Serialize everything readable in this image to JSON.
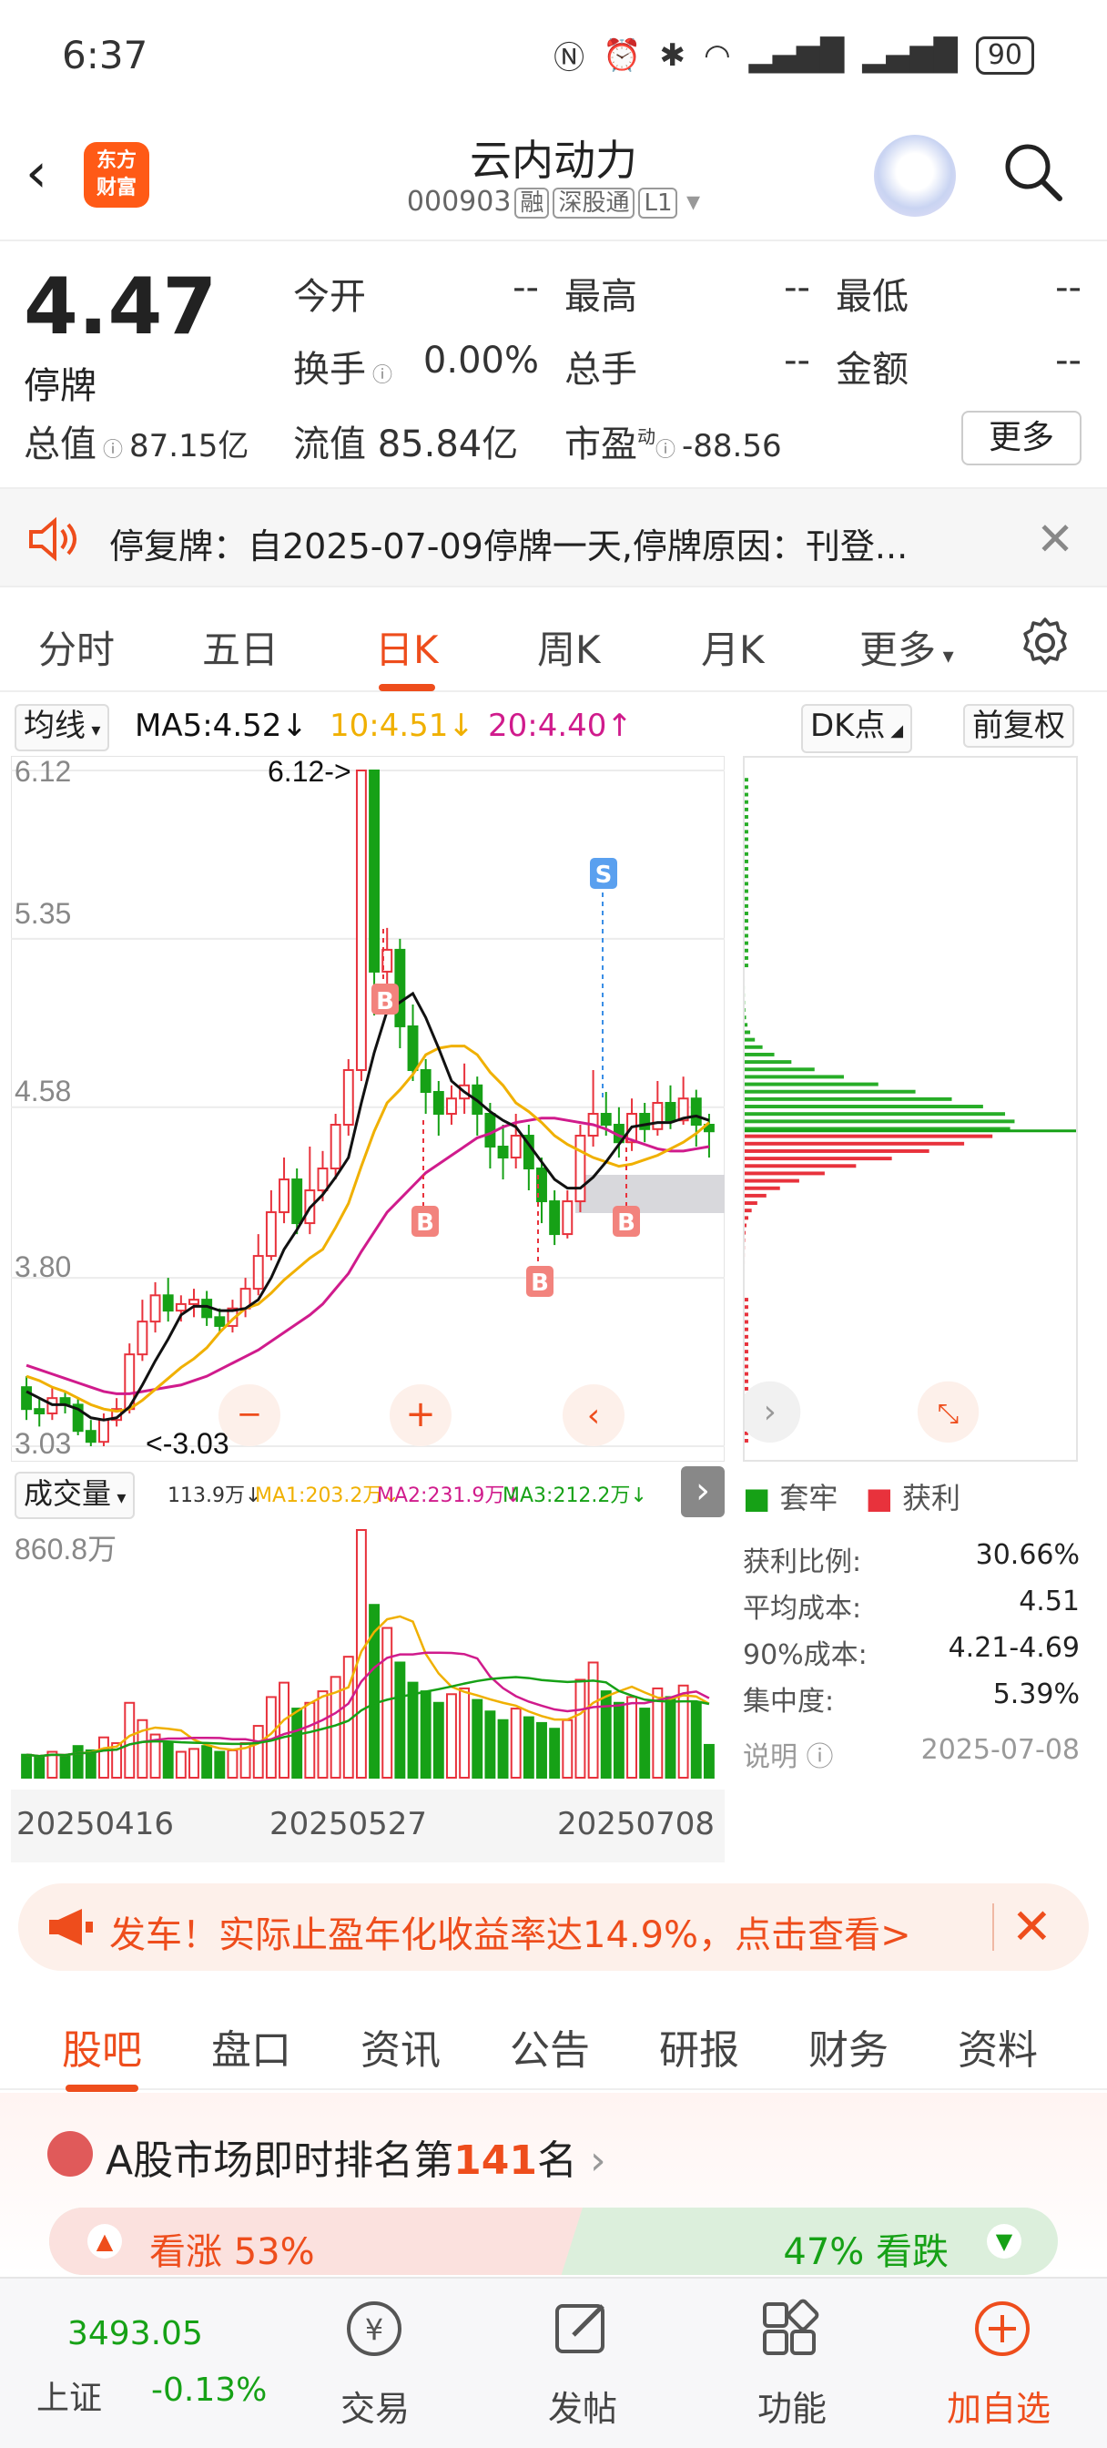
{
  "status_bar": {
    "time": "6:37",
    "battery": "90"
  },
  "header": {
    "logo_line1": "东方",
    "logo_line2": "财富",
    "stock_name": "云内动力",
    "stock_code": "000903",
    "tags": [
      "融",
      "深股通",
      "L1"
    ]
  },
  "quote": {
    "price": "4.47",
    "status": "停牌",
    "fields": [
      {
        "label": "今开",
        "value": "--"
      },
      {
        "label": "最高",
        "value": "--"
      },
      {
        "label": "最低",
        "value": "--"
      },
      {
        "label": "换手",
        "value": "0.00%"
      },
      {
        "label": "总手",
        "value": "--"
      },
      {
        "label": "金额",
        "value": "--"
      }
    ],
    "total_value_label": "总值",
    "total_value": "87.15亿",
    "float_value_label": "流值",
    "float_value": "85.84亿",
    "pe_label": "市盈",
    "pe_sup": "动",
    "pe_value": "-88.56",
    "more": "更多"
  },
  "notice": {
    "text": "停复牌：自2025-07-09停牌一天,停牌原因：刊登..."
  },
  "chart_tabs": [
    "分时",
    "五日",
    "日K",
    "周K",
    "月K",
    "更多"
  ],
  "active_tab": "日K",
  "ma_bar": {
    "selector": "均线",
    "ma5": "MA5:4.52",
    "ma10": "10:4.51",
    "ma20": "20:4.40",
    "dk": "DK点",
    "adjust": "前复权"
  },
  "colors": {
    "accent": "#ee4d1c",
    "up": "#e8323c",
    "down": "#16a116",
    "ma5": "#111111",
    "ma10": "#f0b000",
    "ma20": "#d01b8c"
  },
  "chart_data": {
    "type": "candlestick",
    "y_ticks": [
      "6.12",
      "5.35",
      "4.58",
      "3.80",
      "3.03"
    ],
    "ylim": [
      3.03,
      6.12
    ],
    "max_label": "6.12->",
    "min_label": "<-3.03",
    "signal_labels": [
      "B",
      "B",
      "B",
      "B",
      "S"
    ],
    "candles": [
      [
        3.3,
        3.2,
        3.35,
        3.15
      ],
      [
        3.2,
        3.18,
        3.25,
        3.12
      ],
      [
        3.18,
        3.25,
        3.3,
        3.15
      ],
      [
        3.25,
        3.22,
        3.28,
        3.18
      ],
      [
        3.22,
        3.1,
        3.25,
        3.08
      ],
      [
        3.1,
        3.05,
        3.15,
        3.03
      ],
      [
        3.05,
        3.15,
        3.18,
        3.03
      ],
      [
        3.15,
        3.2,
        3.25,
        3.12
      ],
      [
        3.2,
        3.45,
        3.5,
        3.18
      ],
      [
        3.45,
        3.6,
        3.7,
        3.42
      ],
      [
        3.6,
        3.72,
        3.78,
        3.55
      ],
      [
        3.72,
        3.65,
        3.8,
        3.6
      ],
      [
        3.65,
        3.68,
        3.72,
        3.6
      ],
      [
        3.68,
        3.7,
        3.75,
        3.62
      ],
      [
        3.7,
        3.62,
        3.74,
        3.58
      ],
      [
        3.62,
        3.58,
        3.66,
        3.55
      ],
      [
        3.58,
        3.66,
        3.7,
        3.55
      ],
      [
        3.66,
        3.75,
        3.8,
        3.62
      ],
      [
        3.75,
        3.9,
        4.0,
        3.72
      ],
      [
        3.9,
        4.1,
        4.2,
        3.88
      ],
      [
        4.1,
        4.25,
        4.35,
        4.05
      ],
      [
        4.25,
        4.05,
        4.3,
        4.0
      ],
      [
        4.05,
        4.2,
        4.4,
        4.0
      ],
      [
        4.2,
        4.3,
        4.38,
        4.15
      ],
      [
        4.3,
        4.5,
        4.55,
        4.25
      ],
      [
        4.5,
        4.75,
        4.8,
        4.45
      ],
      [
        4.75,
        6.12,
        6.12,
        4.7
      ],
      [
        6.12,
        5.2,
        6.12,
        5.0
      ],
      [
        5.2,
        5.3,
        5.4,
        5.05
      ],
      [
        5.3,
        4.95,
        5.35,
        4.85
      ],
      [
        4.95,
        4.75,
        5.05,
        4.7
      ],
      [
        4.75,
        4.65,
        4.8,
        4.55
      ],
      [
        4.65,
        4.55,
        4.7,
        4.45
      ],
      [
        4.55,
        4.62,
        4.68,
        4.5
      ],
      [
        4.62,
        4.68,
        4.78,
        4.55
      ],
      [
        4.68,
        4.55,
        4.72,
        4.45
      ],
      [
        4.55,
        4.4,
        4.6,
        4.3
      ],
      [
        4.4,
        4.35,
        4.5,
        4.25
      ],
      [
        4.35,
        4.45,
        4.55,
        4.3
      ],
      [
        4.45,
        4.3,
        4.5,
        4.2
      ],
      [
        4.3,
        4.15,
        4.35,
        4.05
      ],
      [
        4.15,
        4.0,
        4.2,
        3.95
      ],
      [
        4.0,
        4.15,
        4.2,
        3.98
      ],
      [
        4.15,
        4.45,
        4.5,
        4.1
      ],
      [
        4.45,
        4.55,
        4.75,
        4.4
      ],
      [
        4.55,
        4.5,
        4.65,
        4.45
      ],
      [
        4.5,
        4.42,
        4.58,
        4.35
      ],
      [
        4.42,
        4.55,
        4.62,
        4.38
      ],
      [
        4.55,
        4.48,
        4.6,
        4.42
      ],
      [
        4.48,
        4.6,
        4.7,
        4.45
      ],
      [
        4.6,
        4.52,
        4.68,
        4.48
      ],
      [
        4.52,
        4.62,
        4.72,
        4.5
      ],
      [
        4.62,
        4.5,
        4.66,
        4.4
      ],
      [
        4.5,
        4.47,
        4.55,
        4.35
      ]
    ],
    "ma5": [
      3.28,
      3.25,
      3.22,
      3.22,
      3.2,
      3.16,
      3.15,
      3.16,
      3.21,
      3.31,
      3.42,
      3.52,
      3.63,
      3.67,
      3.67,
      3.65,
      3.65,
      3.66,
      3.7,
      3.8,
      3.93,
      4.02,
      4.12,
      4.18,
      4.26,
      4.35,
      4.6,
      4.83,
      5.02,
      5.06,
      5.1,
      4.99,
      4.85,
      4.7,
      4.65,
      4.61,
      4.56,
      4.52,
      4.49,
      4.41,
      4.33,
      4.25,
      4.21,
      4.21,
      4.26,
      4.33,
      4.41,
      4.49,
      4.5,
      4.51,
      4.51,
      4.53,
      4.54,
      4.52
    ],
    "ma10": [
      3.35,
      3.33,
      3.3,
      3.28,
      3.25,
      3.22,
      3.2,
      3.19,
      3.2,
      3.24,
      3.29,
      3.34,
      3.39,
      3.43,
      3.48,
      3.55,
      3.61,
      3.66,
      3.68,
      3.73,
      3.79,
      3.84,
      3.89,
      3.93,
      4.03,
      4.14,
      4.31,
      4.47,
      4.6,
      4.66,
      4.73,
      4.82,
      4.85,
      4.86,
      4.86,
      4.82,
      4.74,
      4.68,
      4.6,
      4.56,
      4.51,
      4.45,
      4.41,
      4.38,
      4.35,
      4.33,
      4.31,
      4.32,
      4.34,
      4.36,
      4.39,
      4.42,
      4.46,
      4.51
    ],
    "ma20": [
      3.4,
      3.38,
      3.36,
      3.34,
      3.32,
      3.3,
      3.28,
      3.27,
      3.27,
      3.28,
      3.29,
      3.3,
      3.31,
      3.33,
      3.35,
      3.38,
      3.41,
      3.44,
      3.47,
      3.51,
      3.55,
      3.59,
      3.63,
      3.68,
      3.75,
      3.82,
      3.92,
      4.01,
      4.1,
      4.16,
      4.22,
      4.28,
      4.32,
      4.36,
      4.4,
      4.44,
      4.46,
      4.49,
      4.51,
      4.52,
      4.53,
      4.53,
      4.52,
      4.51,
      4.5,
      4.48,
      4.45,
      4.43,
      4.41,
      4.39,
      4.38,
      4.38,
      4.39,
      4.4
    ]
  },
  "volume": {
    "selector": "成交量",
    "vol": "113.9万",
    "ma1": "MA1:203.2万",
    "ma2": "MA2:231.9万",
    "ma3": "MA3:212.2万",
    "max": "860.8万",
    "dates": [
      "20250416",
      "20250527",
      "20250708"
    ],
    "values": [
      80,
      70,
      90,
      75,
      110,
      95,
      140,
      120,
      260,
      200,
      150,
      120,
      90,
      100,
      110,
      90,
      95,
      120,
      180,
      280,
      330,
      240,
      260,
      300,
      350,
      420,
      860,
      600,
      520,
      400,
      330,
      300,
      260,
      290,
      310,
      270,
      230,
      200,
      240,
      210,
      190,
      170,
      200,
      340,
      400,
      300,
      260,
      280,
      240,
      310,
      280,
      320,
      260,
      114
    ]
  },
  "distribution": {
    "legend_trap": "套牢",
    "legend_profit": "获利",
    "stats": [
      {
        "label": "获利比例:",
        "value": "30.66%"
      },
      {
        "label": "平均成本:",
        "value": "4.51"
      },
      {
        "label": "90%成本:",
        "value": "4.21-4.69"
      },
      {
        "label": "集中度:",
        "value": "5.39%"
      }
    ],
    "note_label": "说明",
    "date": "2025-07-08"
  },
  "ad": {
    "text": "发车！实际止盈年化收益率达14.9%，点击查看>"
  },
  "sub_tabs": [
    "股吧",
    "盘口",
    "资讯",
    "公告",
    "研报",
    "财务",
    "资料"
  ],
  "rank": {
    "prefix": "A股市场即时排名第",
    "number": "141",
    "suffix": "名",
    "bull": "看涨 53%",
    "bear": "47% 看跌"
  },
  "bottom_bar": {
    "index_value": "3493.05",
    "index_name": "上证",
    "index_change": "-0.13%",
    "items": [
      "交易",
      "发帖",
      "功能",
      "加自选"
    ]
  }
}
